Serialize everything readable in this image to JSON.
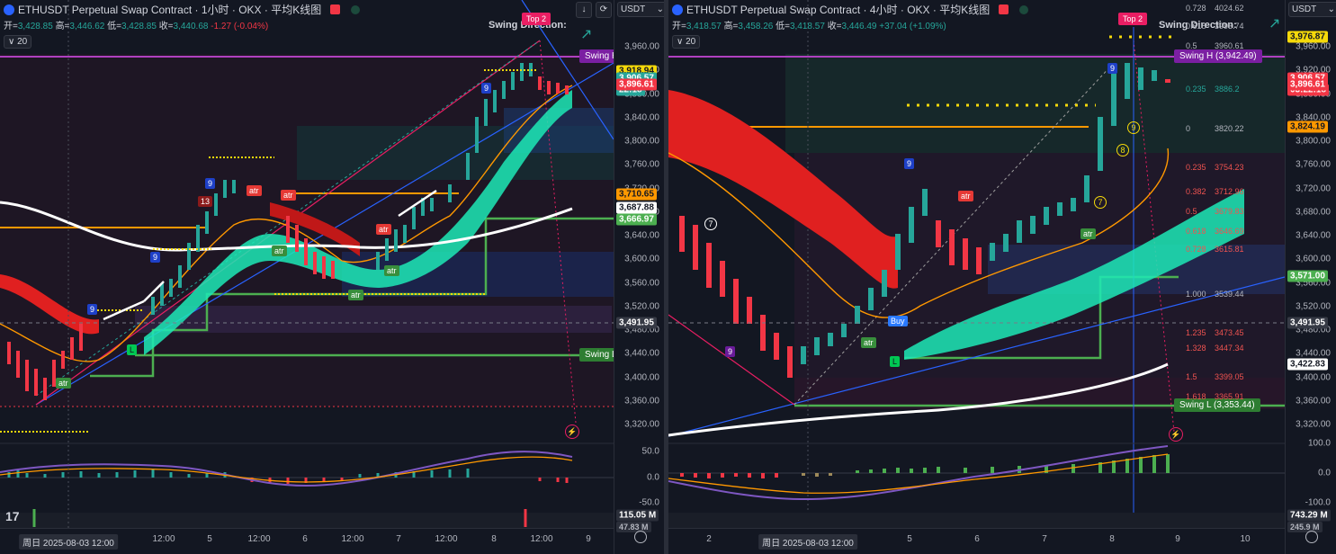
{
  "left_chart": {
    "title": "ETHUSDT Perpetual Swap Contract · 1小时 · OKX · 平均K线图",
    "ohlc": {
      "open_label": "开=",
      "open": "3,428.85",
      "high_label": "高=",
      "high": "3,446.62",
      "low_label": "低=",
      "low": "3,428.85",
      "close_label": "收=",
      "close": "3,440.68",
      "change": "-1.27 (-0.04%)"
    },
    "interval_badge": "20",
    "currency": "USDT",
    "swing_direction": "Swing Direction:",
    "top_badge": "Top 2",
    "swing_h": "Swing H",
    "swing_l": "Swing L",
    "price_tags": [
      {
        "value": "3,918.94",
        "bg": "#f5d90a",
        "fg": "#131722"
      },
      {
        "value": "3,906.57",
        "bg": "#26a69a",
        "fg": "#ffffff"
      },
      {
        "value": "22:18",
        "bg": "#26a69a",
        "fg": "#ffffff"
      },
      {
        "value": "3,896.61",
        "bg": "#f23645",
        "fg": "#ffffff"
      },
      {
        "value": "3,710.65",
        "bg": "#ff9800",
        "fg": "#131722"
      },
      {
        "value": "3,687.88",
        "bg": "#ffffff",
        "fg": "#131722"
      },
      {
        "value": "3,666.97",
        "bg": "#4caf50",
        "fg": "#ffffff"
      },
      {
        "value": "3,491.95",
        "bg": "#363a45",
        "fg": "#ffffff"
      }
    ],
    "y_ticks": [
      "3,960.00",
      "3,920.00",
      "3,880.00",
      "3,840.00",
      "3,800.00",
      "3,760.00",
      "3,720.00",
      "3,680.00",
      "3,640.00",
      "3,600.00",
      "3,560.00",
      "3,520.00",
      "3,480.00",
      "3,440.00",
      "3,400.00",
      "3,360.00",
      "3,320.00"
    ],
    "osc_ticks": [
      "50.0",
      "0.0",
      "-50.0"
    ],
    "volume_tag": "115.05 M",
    "volume_tag2": "47.83 M",
    "x_labels": [
      "周日 2025-08-03   12:00",
      "12:00",
      "5",
      "12:00",
      "6",
      "12:00",
      "7",
      "12:00",
      "8",
      "12:00",
      "9"
    ],
    "markers": [
      "9",
      "13",
      "9",
      "9",
      "9"
    ],
    "atr_labels": [
      "atr",
      "atr",
      "atr",
      "atr",
      "atr",
      "atr",
      "atr"
    ]
  },
  "right_chart": {
    "title": "ETHUSDT Perpetual Swap Contract · 4小时 · OKX · 平均K线图",
    "ohlc": {
      "open_label": "开=",
      "open": "3,418.57",
      "high_label": "高=",
      "high": "3,458.26",
      "low_label": "低=",
      "low": "3,418.57",
      "close_label": "收=",
      "close": "3,446.49",
      "change": "+37.04 (+1.09%)"
    },
    "interval_badge": "20",
    "currency": "USDT",
    "swing_direction": "Swing Direction:",
    "top_badge": "Top 2",
    "swing_h": "Swing H  (3,942.49)",
    "swing_l": "Swing L  (3,353.44)",
    "buy_label": "Buy",
    "fib_levels": [
      {
        "ratio": "0.728",
        "value": "4024.62"
      },
      {
        "ratio": "0.618",
        "value": "3993.74"
      },
      {
        "ratio": "0.5",
        "value": "3960.61"
      },
      {
        "ratio": "0.235",
        "value": "3886.2"
      },
      {
        "ratio": "0",
        "value": "3820.22"
      },
      {
        "ratio": "0.235",
        "value": "3754.23"
      },
      {
        "ratio": "0.382",
        "value": "3712.96"
      },
      {
        "ratio": "0.5",
        "value": "3679.83"
      },
      {
        "ratio": "0.618",
        "value": "3646.69"
      },
      {
        "ratio": "0.728",
        "value": "3615.81"
      },
      {
        "ratio": "1.000",
        "value": "3539.44"
      },
      {
        "ratio": "1.235",
        "value": "3473.45"
      },
      {
        "ratio": "1.328",
        "value": "3447.34"
      },
      {
        "ratio": "1.5",
        "value": "3399.05"
      },
      {
        "ratio": "1.618",
        "value": "3365.91"
      }
    ],
    "price_tags": [
      {
        "value": "3,976.87",
        "bg": "#f5d90a",
        "fg": "#131722"
      },
      {
        "value": "3,906.57",
        "bg": "#f23645",
        "fg": "#ffffff"
      },
      {
        "value": "03:22:18",
        "bg": "#f23645",
        "fg": "#ffffff"
      },
      {
        "value": "3,896.61",
        "bg": "#f23645",
        "fg": "#ffffff"
      },
      {
        "value": "3,824.19",
        "bg": "#ff9800",
        "fg": "#131722"
      },
      {
        "value": "3,571.00",
        "bg": "#4caf50",
        "fg": "#ffffff"
      },
      {
        "value": "3,491.95",
        "bg": "#363a45",
        "fg": "#ffffff"
      },
      {
        "value": "3,422.83",
        "bg": "#ffffff",
        "fg": "#131722"
      }
    ],
    "y_ticks": [
      "3,960.00",
      "3,920.00",
      "3,880.00",
      "3,840.00",
      "3,800.00",
      "3,760.00",
      "3,720.00",
      "3,680.00",
      "3,640.00",
      "3,600.00",
      "3,560.00",
      "3,520.00",
      "3,480.00",
      "3,440.00",
      "3,400.00",
      "3,360.00",
      "3,320.00"
    ],
    "osc_ticks": [
      "100.0",
      "0.0",
      "-100.0"
    ],
    "volume_tag": "743.29 M",
    "volume_tag2": "245.9 M",
    "x_labels": [
      "2",
      "周日 2025-08-03   12:00",
      "5",
      "6",
      "7",
      "8",
      "9",
      "10"
    ],
    "markers": [
      "9",
      "9",
      "9"
    ],
    "seq_markers": [
      "7",
      "8",
      "9"
    ],
    "atr_labels": [
      "atr",
      "atr",
      "atr"
    ]
  }
}
